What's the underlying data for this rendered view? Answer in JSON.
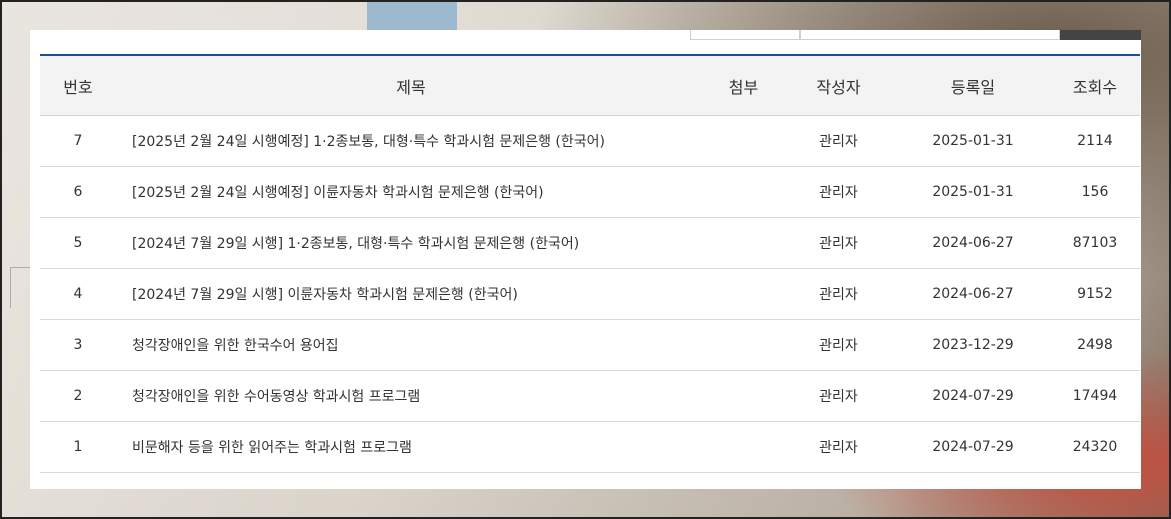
{
  "board": {
    "headers": {
      "num": "번호",
      "title": "제목",
      "attachment": "첨부",
      "author": "작성자",
      "date": "등록일",
      "views": "조회수"
    },
    "rows": [
      {
        "num": "7",
        "title": "[2025년 2월 24일 시행예정] 1·2종보통, 대형·특수 학과시험 문제은행 (한국어)",
        "author": "관리자",
        "date": "2025-01-31",
        "views": "2114"
      },
      {
        "num": "6",
        "title": "[2025년 2월 24일 시행예정] 이륜자동차 학과시험 문제은행 (한국어)",
        "author": "관리자",
        "date": "2025-01-31",
        "views": "156"
      },
      {
        "num": "5",
        "title": "[2024년 7월 29일 시행] 1·2종보통, 대형·특수 학과시험 문제은행 (한국어)",
        "author": "관리자",
        "date": "2024-06-27",
        "views": "87103"
      },
      {
        "num": "4",
        "title": "[2024년 7월 29일 시행] 이륜자동차 학과시험 문제은행 (한국어)",
        "author": "관리자",
        "date": "2024-06-27",
        "views": "9152"
      },
      {
        "num": "3",
        "title": "청각장애인을 위한 한국수어 용어집",
        "author": "관리자",
        "date": "2023-12-29",
        "views": "2498"
      },
      {
        "num": "2",
        "title": "청각장애인을 위한 수어동영상 학과시험 프로그램",
        "author": "관리자",
        "date": "2024-07-29",
        "views": "17494"
      },
      {
        "num": "1",
        "title": "비문해자 등을 위한 읽어주는 학과시험 프로그램",
        "author": "관리자",
        "date": "2024-07-29",
        "views": "24320"
      }
    ]
  },
  "colors": {
    "accent_border": "#1f4e99",
    "header_bg": "#f3f3f3"
  }
}
